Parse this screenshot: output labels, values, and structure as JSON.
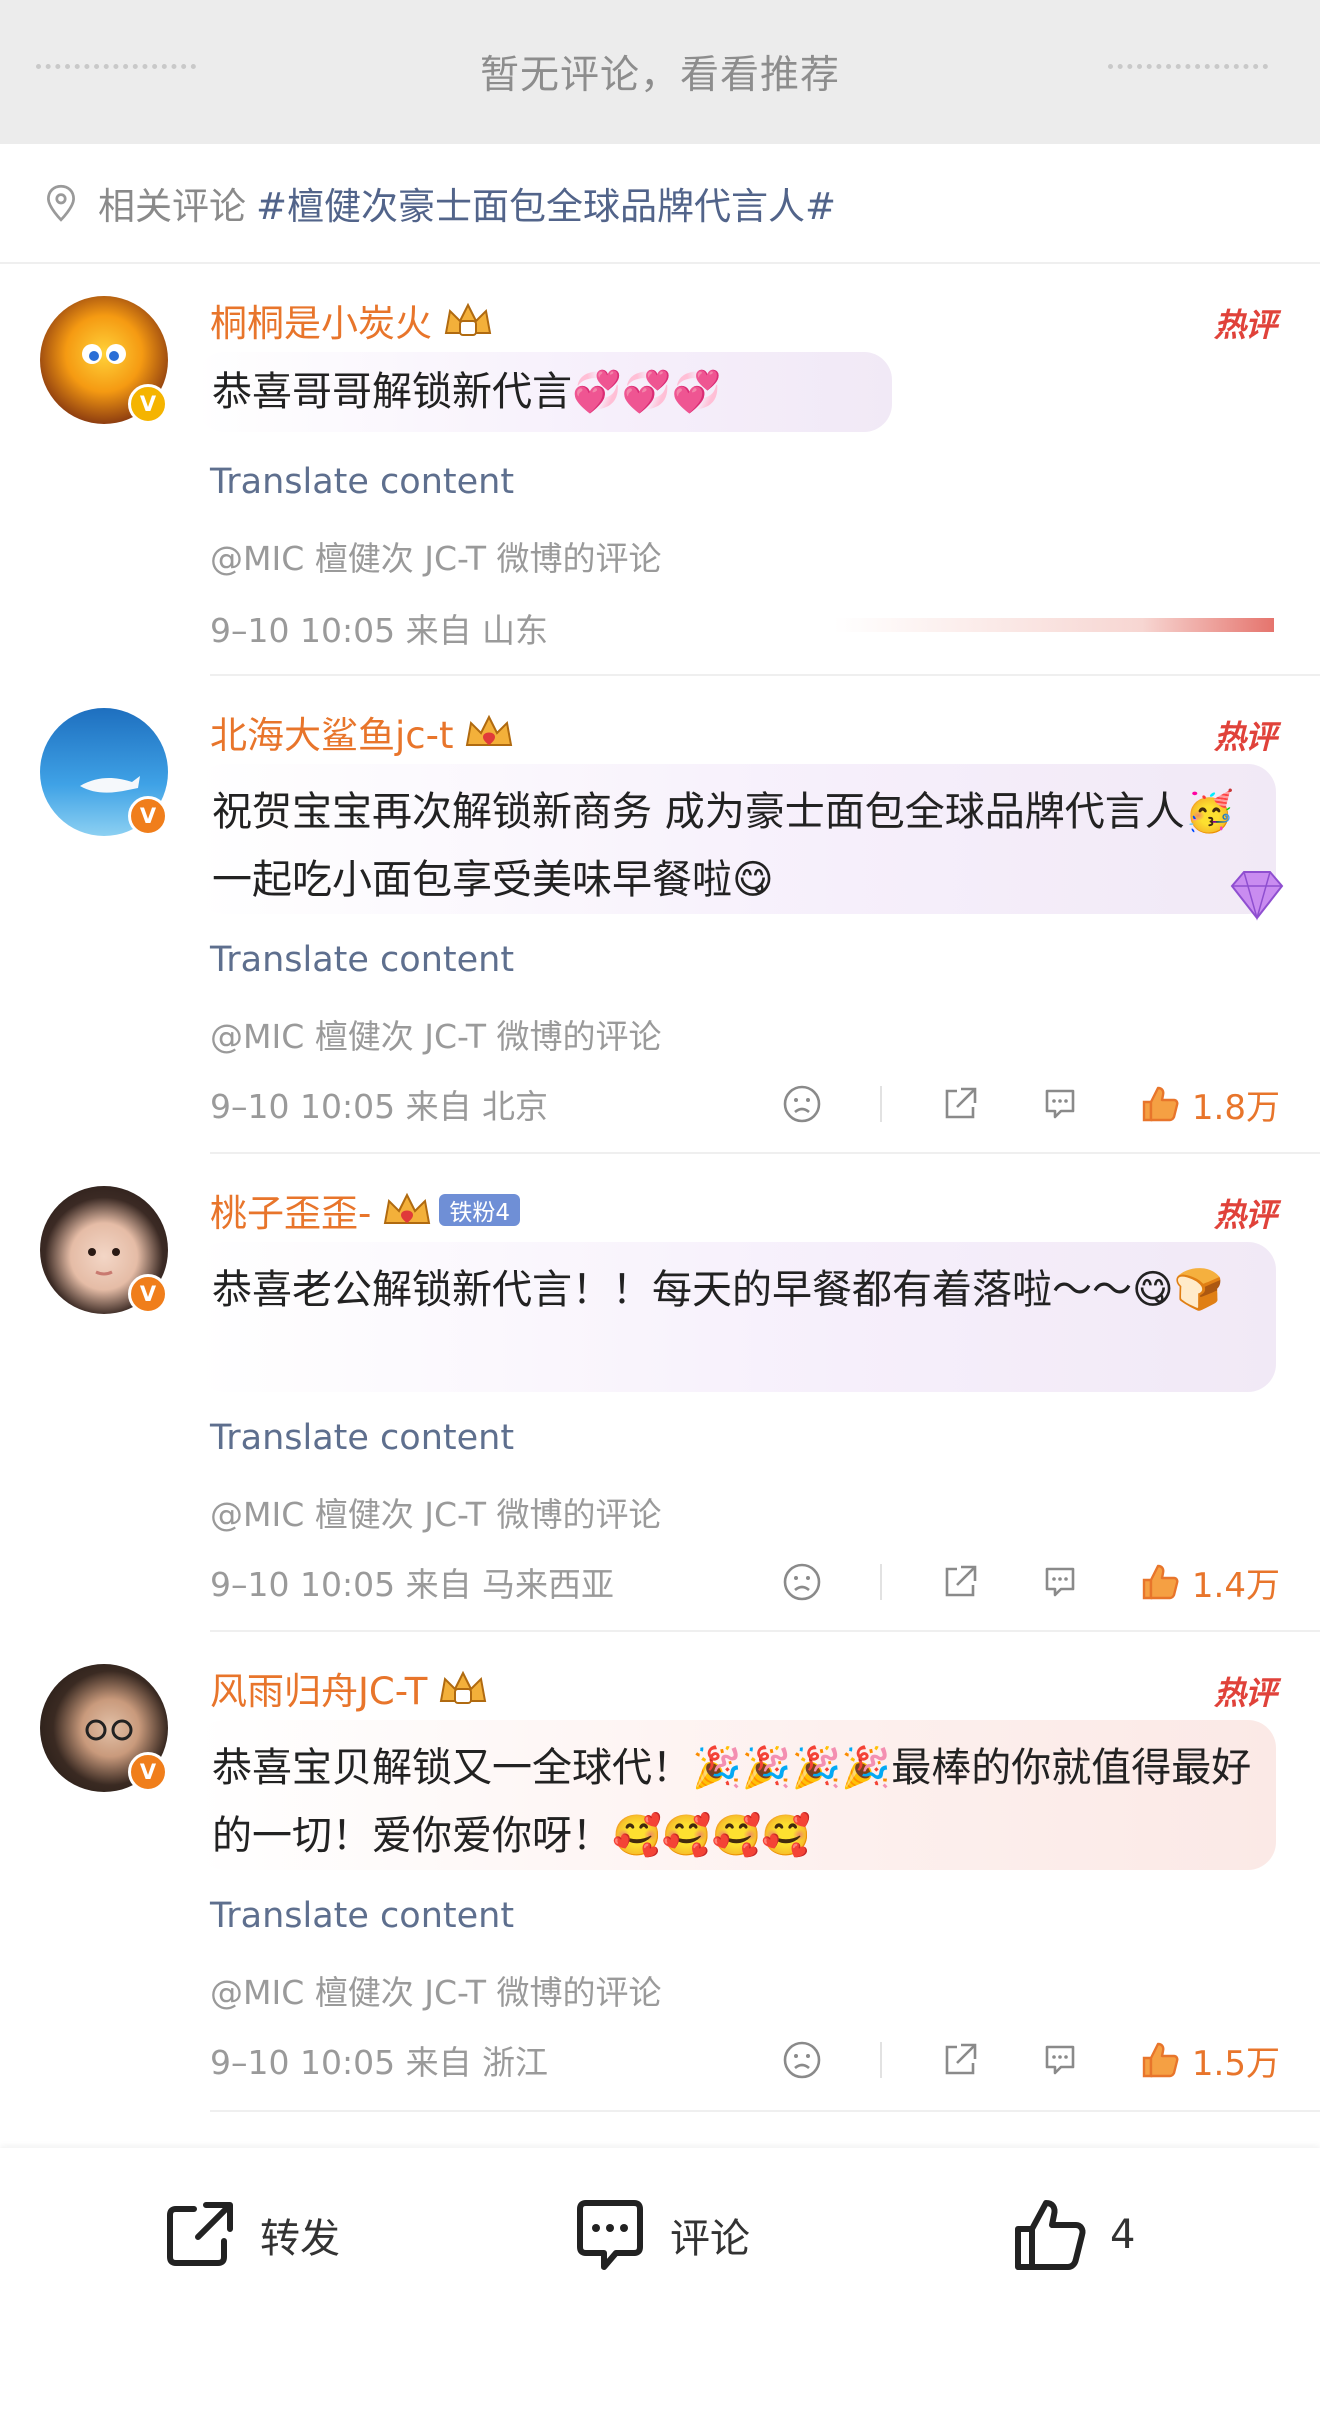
{
  "banner": {
    "text": "暂无评论，看看推荐"
  },
  "related": {
    "label": "相关评论",
    "tag": "#檀健次豪士面包全球品牌代言人#"
  },
  "hot_label": "热评",
  "comments": [
    {
      "username": "桐桐是小炭火",
      "fan_badge": "",
      "text": "恭喜哥哥解锁新代言💞💞💞",
      "translate": "Translate content",
      "source": "@MIC 檀健次 JC-T 微博的评论",
      "time": "9–10 10:05  来自 山东",
      "likes": ""
    },
    {
      "username": "北海大鲨鱼jc-t",
      "fan_badge": "",
      "text": "祝贺宝宝再次解锁新商务  成为豪士面包全球品牌代言人🥳  一起吃小面包享受美味早餐啦😋",
      "translate": "Translate content",
      "source": "@MIC 檀健次 JC-T 微博的评论",
      "time": "9–10 10:05  来自 北京",
      "likes": "1.8万"
    },
    {
      "username": "桃子歪歪-",
      "fan_badge": "铁粉4",
      "text": "恭喜老公解锁新代言！！每天的早餐都有着落啦～～😋🍞",
      "translate": "Translate content",
      "source": "@MIC 檀健次 JC-T 微博的评论",
      "time": "9–10 10:05  来自 马来西亚",
      "likes": "1.4万"
    },
    {
      "username": "风雨归舟JC-T",
      "fan_badge": "",
      "text": "恭喜宝贝解锁又一全球代！🎉🎉🎉🎉最棒的你就值得最好的一切！爱你爱你呀！🥰🥰🥰🥰",
      "translate": "Translate content",
      "source": "@MIC 檀健次 JC-T 微博的评论",
      "time": "9–10 10:05  来自 浙江",
      "likes": "1.5万"
    }
  ],
  "bottom_bar": {
    "repost": "转发",
    "comment": "评论",
    "like_count": "4"
  },
  "colors": {
    "username": "#e8752b",
    "hot": "#e0423a",
    "link": "#5e6f8e",
    "tag": "#52648a"
  },
  "icons": [
    "location-pin-icon",
    "crown-icon",
    "verified-icon",
    "dislike-icon",
    "share-icon",
    "comment-icon",
    "thumbs-up-icon",
    "repost-icon"
  ]
}
